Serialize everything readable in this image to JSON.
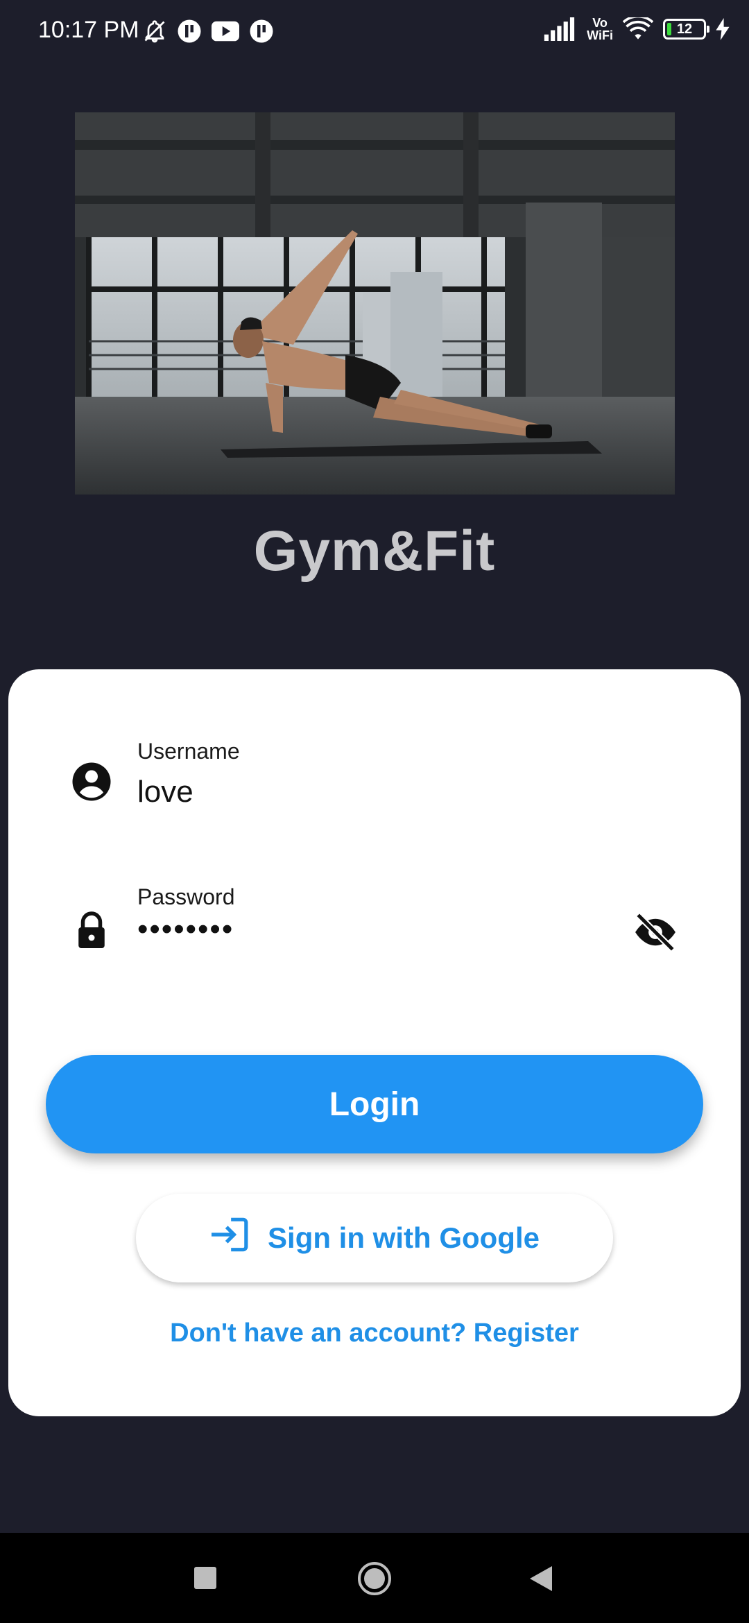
{
  "status_bar": {
    "time": "10:17 PM",
    "icons_left": [
      "bell-off-icon",
      "app-icon",
      "youtube-icon",
      "app-icon"
    ],
    "icons_right": [
      "signal-icon",
      "vowifi-icon",
      "wifi-icon",
      "battery-icon",
      "charging-icon"
    ],
    "vowifi_top": "Vo",
    "vowifi_bottom": "WiFi",
    "battery_level": "12"
  },
  "hero": {
    "image": "man-doing-side-plank-in-gym"
  },
  "app": {
    "title": "Gym&Fit"
  },
  "form": {
    "username": {
      "label": "Username",
      "value": "love",
      "icon": "account-circle-icon"
    },
    "password": {
      "label": "Password",
      "value": "••••••••",
      "icon": "lock-icon",
      "toggle_icon": "eye-off-icon"
    },
    "login_label": "Login",
    "google_label": "Sign in with Google",
    "google_icon": "login-arrow-icon",
    "register_label": "Don't have an account? Register"
  },
  "nav_bar": {
    "icons": [
      "recents-icon",
      "home-icon",
      "back-icon"
    ]
  },
  "colors": {
    "background": "#1d1e2b",
    "primary": "#2194f3",
    "link": "#1f8fe6",
    "card": "#ffffff",
    "title": "#c9c9cc"
  }
}
